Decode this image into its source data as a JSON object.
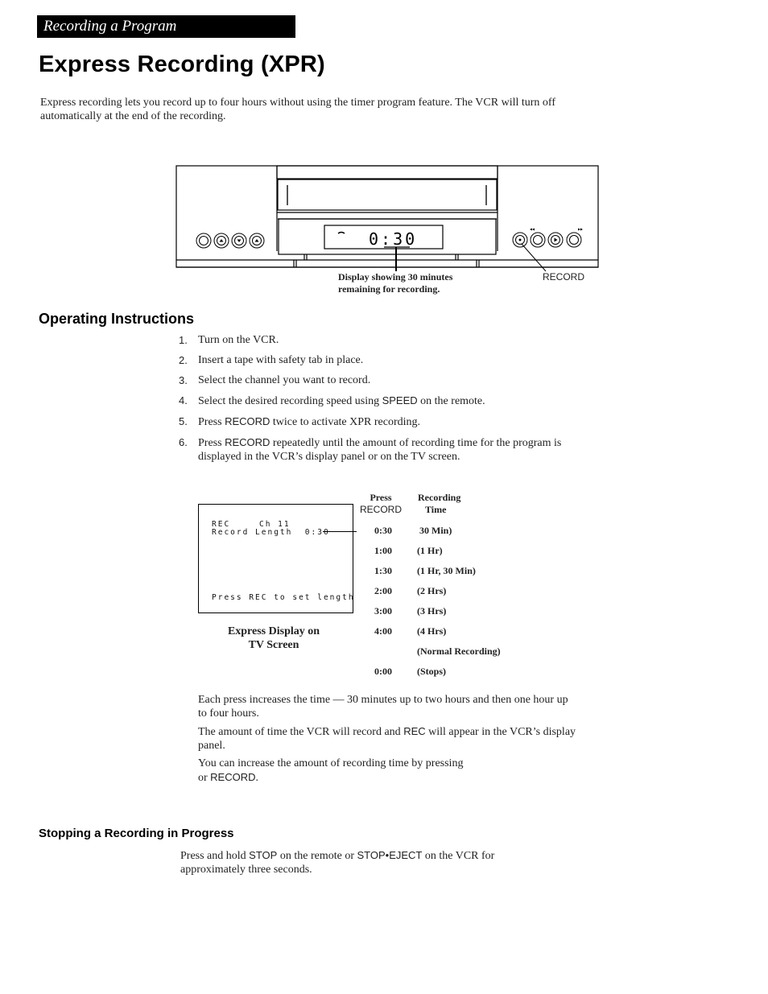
{
  "header": {
    "section_banner": "Recording a Program",
    "page_title": "Express Recording (XPR)"
  },
  "intro": "Express recording lets you record up to four hours without using the timer program feature.  The VCR will turn off automatically at the end of the recording.",
  "vcr_figure": {
    "display_readout": "0:30",
    "display_caption_line1": "Display showing 30 minutes",
    "display_caption_line2": "remaining for recording.",
    "record_callout": "RECORD",
    "left_buttons": [
      "power-button",
      "eject-button",
      "channel-down-button",
      "channel-up-button"
    ],
    "right_buttons": [
      "record-button",
      "rewind-button",
      "play-button",
      "fast-forward-button"
    ]
  },
  "operating": {
    "heading": "Operating Instructions",
    "steps": [
      {
        "num": "1.",
        "parts": [
          "Turn on the VCR.",
          "",
          ""
        ]
      },
      {
        "num": "2.",
        "parts": [
          "Insert a tape with safety tab in place.",
          "",
          ""
        ]
      },
      {
        "num": "3.",
        "parts": [
          "Select the channel you want to record.",
          "",
          ""
        ]
      },
      {
        "num": "4.",
        "parts": [
          "Select the desired recording speed using ",
          "SPEED",
          " on the remote."
        ]
      },
      {
        "num": "5.",
        "parts": [
          "Press ",
          "RECORD",
          " twice to activate XPR recording."
        ]
      },
      {
        "num": "6.",
        "parts": [
          "Press ",
          "RECORD",
          " repeatedly until the amount of recording time for the program is displayed in the VCR’s display panel or on the TV screen."
        ]
      }
    ]
  },
  "tv_display": {
    "line1_rec": "REC",
    "line1_channel": "Ch 11",
    "line2": "Record Length  0:30",
    "line3": "Press REC to set length",
    "caption_line1": "Express Display on",
    "caption_line2": "TV Screen"
  },
  "record_table": {
    "col1_header_line1": "Press",
    "col1_header_line2": "RECORD",
    "col2_header_line1": "Recording",
    "col2_header_line2": "Time",
    "rows": [
      {
        "press": "0:30",
        "time": " 30 Min)"
      },
      {
        "press": "1:00",
        "time": "(1 Hr)"
      },
      {
        "press": "1:30",
        "time": "(1 Hr, 30 Min)"
      },
      {
        "press": "2:00",
        "time": "(2 Hrs)"
      },
      {
        "press": "3:00",
        "time": "(3 Hrs)"
      },
      {
        "press": "4:00",
        "time": "(4 Hrs)"
      },
      {
        "press": "",
        "time": "(Normal Recording)"
      },
      {
        "press": "0:00",
        "time": "(Stops)"
      }
    ]
  },
  "notes": {
    "p1": "Each press increases the time — 30 minutes up to two hours and then one hour up to four hours.",
    "p2_a": "The amount of time the VCR will record and ",
    "p2_b": "REC",
    "p2_c": " will appear in the VCR’s display panel.",
    "p3_a": "You can increase the amount of recording time by pressing",
    "p3_b": "or ",
    "p3_c": "RECORD",
    "p3_d": "."
  },
  "stopping": {
    "heading": "Stopping a Recording in Progress",
    "text_a": "Press and hold ",
    "text_b": "STOP",
    "text_c": " on the remote or ",
    "text_d": "STOP•EJECT",
    "text_e": " on the VCR for approximately three seconds."
  }
}
